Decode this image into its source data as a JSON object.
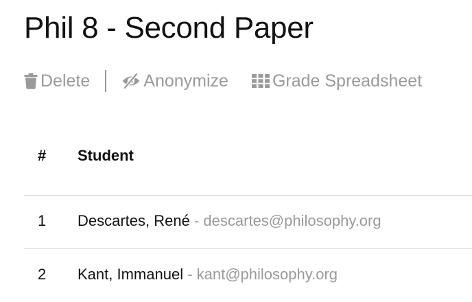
{
  "page": {
    "title": "Phil 8 - Second Paper"
  },
  "toolbar": {
    "delete_label": "Delete",
    "delete_icon": "trash-icon",
    "anonymize_label": "Anonymize",
    "anonymize_icon": "eye-slash-icon",
    "grade_label": "Grade Spreadsheet",
    "grade_icon": "grid-icon",
    "text_color": "#9a9a9a"
  },
  "table": {
    "columns": [
      "#",
      "Student"
    ],
    "rows": [
      {
        "num": "1",
        "name": "Descartes, René",
        "separator": " - ",
        "email": "descartes@philosophy.org"
      },
      {
        "num": "2",
        "name": "Kant, Immanuel",
        "separator": " - ",
        "email": "kant@philosophy.org"
      }
    ]
  }
}
